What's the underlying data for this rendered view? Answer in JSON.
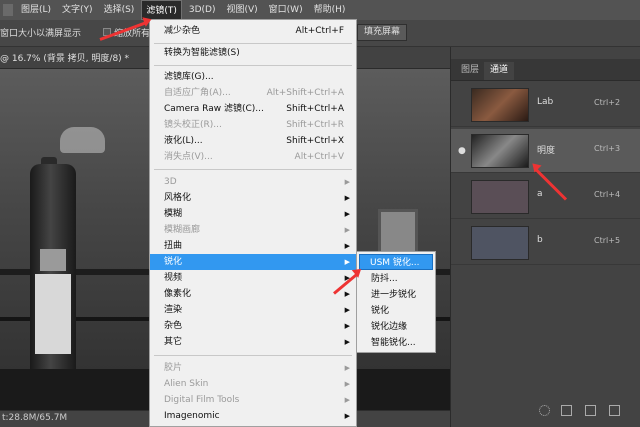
{
  "menubar": {
    "items": [
      "图层(L)",
      "文字(Y)",
      "选择(S)",
      "滤镜(T)",
      "3D(D)",
      "视图(V)",
      "窗口(W)",
      "帮助(H)"
    ]
  },
  "options": {
    "fit_window": "窗口大小以满屏显示",
    "zoom_all": "缩放所有窗口",
    "fill_screen": "填充屏幕"
  },
  "document": {
    "tab_title": "@ 16.7% (背景 拷贝, 明度/8) *",
    "status": "t:28.8M/65.7M"
  },
  "panel": {
    "tabs": [
      "图层",
      "通道"
    ],
    "channels": [
      {
        "name": "Lab",
        "key": "Ctrl+2",
        "visible": false
      },
      {
        "name": "明度",
        "key": "Ctrl+3",
        "visible": true,
        "selected": true
      },
      {
        "name": "a",
        "key": "Ctrl+4",
        "visible": false
      },
      {
        "name": "b",
        "key": "Ctrl+5",
        "visible": false
      }
    ],
    "eye_icon": "eye-icon"
  },
  "filter_menu": {
    "items": [
      {
        "label": "减少杂色",
        "shortcut": "Alt+Ctrl+F"
      },
      {
        "label": "转换为智能滤镜(S)"
      },
      {
        "label": "滤镜库(G)..."
      },
      {
        "label": "自适应广角(A)...",
        "shortcut": "Alt+Shift+Ctrl+A",
        "disabled": true
      },
      {
        "label": "Camera Raw 滤镜(C)...",
        "shortcut": "Shift+Ctrl+A"
      },
      {
        "label": "镜头校正(R)...",
        "shortcut": "Shift+Ctrl+R",
        "disabled": true
      },
      {
        "label": "液化(L)...",
        "shortcut": "Shift+Ctrl+X"
      },
      {
        "label": "消失点(V)...",
        "shortcut": "Alt+Ctrl+V",
        "disabled": true
      },
      {
        "label": "3D",
        "submenu": true,
        "disabled": true
      },
      {
        "label": "风格化",
        "submenu": true
      },
      {
        "label": "模糊",
        "submenu": true
      },
      {
        "label": "模糊画廊",
        "submenu": true,
        "disabled": true
      },
      {
        "label": "扭曲",
        "submenu": true
      },
      {
        "label": "锐化",
        "submenu": true,
        "highlighted": true
      },
      {
        "label": "视频",
        "submenu": true
      },
      {
        "label": "像素化",
        "submenu": true
      },
      {
        "label": "渲染",
        "submenu": true
      },
      {
        "label": "杂色",
        "submenu": true
      },
      {
        "label": "其它",
        "submenu": true
      },
      {
        "label": "胶片",
        "submenu": true,
        "disabled": true
      },
      {
        "label": "Alien Skin",
        "submenu": true,
        "disabled": true
      },
      {
        "label": "Digital Film Tools",
        "submenu": true,
        "disabled": true
      },
      {
        "label": "Imagenomic",
        "submenu": true
      }
    ]
  },
  "sharpen_submenu": {
    "items": [
      {
        "label": "USM 锐化...",
        "highlighted": true
      },
      {
        "label": "防抖..."
      },
      {
        "label": "进一步锐化"
      },
      {
        "label": "锐化"
      },
      {
        "label": "锐化边缘"
      },
      {
        "label": "智能锐化..."
      }
    ]
  }
}
